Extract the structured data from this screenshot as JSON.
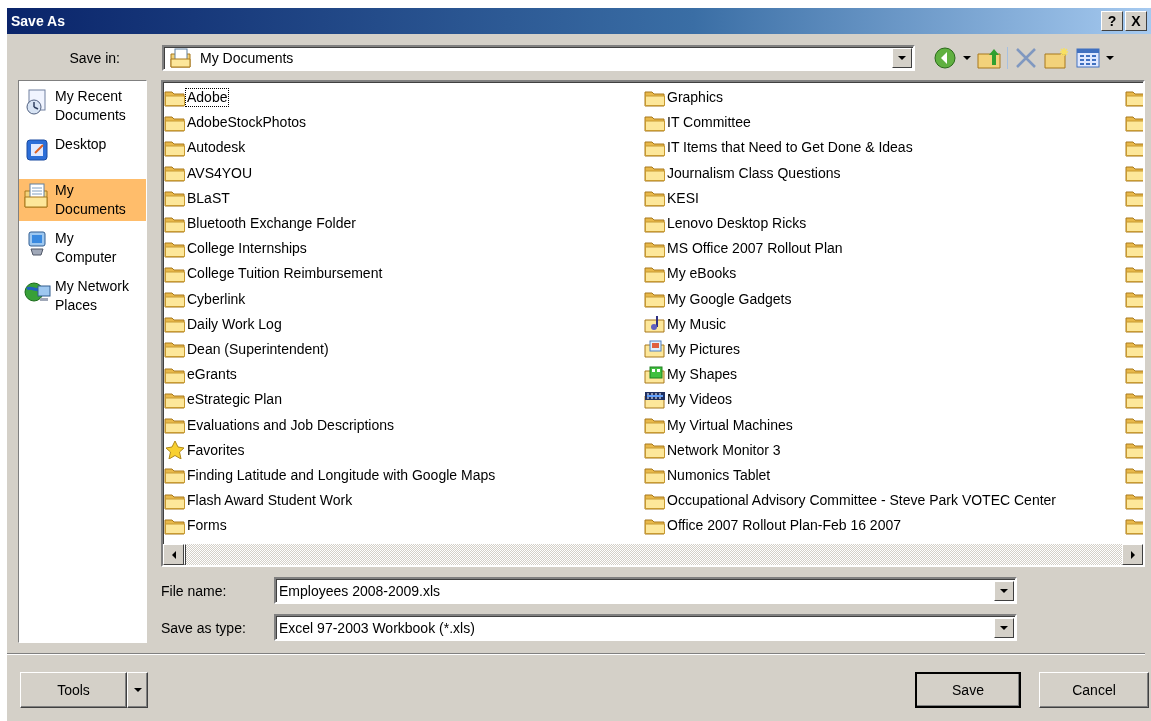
{
  "window": {
    "title": "Save As",
    "title_buttons": [
      "?",
      "X"
    ]
  },
  "save_in": {
    "label": "Save in:",
    "value": "My Documents"
  },
  "places": [
    {
      "kind": "recent",
      "label": "My Recent Documents",
      "selected": false
    },
    {
      "kind": "desktop",
      "label": "Desktop",
      "selected": false
    },
    {
      "kind": "documents",
      "label": "My Documents",
      "selected": true
    },
    {
      "kind": "computer",
      "label": "My Computer",
      "selected": false
    },
    {
      "kind": "network",
      "label": "My Network Places",
      "selected": false
    }
  ],
  "file_list": {
    "columns": [
      {
        "items": [
          {
            "kind": "folder",
            "label": "Adobe",
            "focused": true
          },
          {
            "kind": "folder",
            "label": "AdobeStockPhotos",
            "focused": false
          },
          {
            "kind": "folder",
            "label": "Autodesk",
            "focused": false
          },
          {
            "kind": "folder",
            "label": "AVS4YOU",
            "focused": false
          },
          {
            "kind": "folder",
            "label": "BLaST",
            "focused": false
          },
          {
            "kind": "folder",
            "label": "Bluetooth Exchange Folder",
            "focused": false
          },
          {
            "kind": "folder",
            "label": "College Internships",
            "focused": false
          },
          {
            "kind": "folder",
            "label": "College Tuition Reimbursement",
            "focused": false
          },
          {
            "kind": "folder",
            "label": "Cyberlink",
            "focused": false
          },
          {
            "kind": "folder",
            "label": "Daily Work Log",
            "focused": false
          },
          {
            "kind": "folder",
            "label": "Dean (Superintendent)",
            "focused": false
          },
          {
            "kind": "folder",
            "label": "eGrants",
            "focused": false
          },
          {
            "kind": "folder",
            "label": "eStrategic Plan",
            "focused": false
          },
          {
            "kind": "folder",
            "label": "Evaluations and Job Descriptions",
            "focused": false
          },
          {
            "kind": "favorites",
            "label": "Favorites",
            "focused": false
          },
          {
            "kind": "folder",
            "label": "Finding Latitude and Longitude with Google Maps",
            "focused": false
          },
          {
            "kind": "folder",
            "label": "Flash Award Student Work",
            "focused": false
          },
          {
            "kind": "folder",
            "label": "Forms",
            "focused": false
          }
        ]
      },
      {
        "items": [
          {
            "kind": "folder",
            "label": "Graphics",
            "focused": false
          },
          {
            "kind": "folder",
            "label": "IT Committee",
            "focused": false
          },
          {
            "kind": "folder",
            "label": "IT Items that Need to Get Done & Ideas",
            "focused": false
          },
          {
            "kind": "folder",
            "label": "Journalism Class Questions",
            "focused": false
          },
          {
            "kind": "folder",
            "label": "KESI",
            "focused": false
          },
          {
            "kind": "folder",
            "label": "Lenovo Desktop Ricks",
            "focused": false
          },
          {
            "kind": "folder",
            "label": "MS Office 2007 Rollout Plan",
            "focused": false
          },
          {
            "kind": "folder",
            "label": "My eBooks",
            "focused": false
          },
          {
            "kind": "folder",
            "label": "My Google Gadgets",
            "focused": false
          },
          {
            "kind": "music",
            "label": "My Music",
            "focused": false
          },
          {
            "kind": "pictures",
            "label": "My Pictures",
            "focused": false
          },
          {
            "kind": "shapes",
            "label": "My Shapes",
            "focused": false
          },
          {
            "kind": "videos",
            "label": "My Videos",
            "focused": false
          },
          {
            "kind": "folder",
            "label": "My Virtual Machines",
            "focused": false
          },
          {
            "kind": "folder",
            "label": "Network Monitor 3",
            "focused": false
          },
          {
            "kind": "folder",
            "label": "Numonics Tablet",
            "focused": false
          },
          {
            "kind": "folder",
            "label": "Occupational Advisory Committee - Steve Park VOTEC Center",
            "focused": false
          },
          {
            "kind": "folder",
            "label": "Office 2007 Rollout Plan-Feb 16 2007",
            "focused": false
          }
        ]
      },
      {
        "items": [
          {
            "kind": "folder"
          },
          {
            "kind": "folder"
          },
          {
            "kind": "folder"
          },
          {
            "kind": "folder"
          },
          {
            "kind": "folder"
          },
          {
            "kind": "folder"
          },
          {
            "kind": "folder"
          },
          {
            "kind": "folder"
          },
          {
            "kind": "folder"
          },
          {
            "kind": "folder"
          },
          {
            "kind": "folder"
          },
          {
            "kind": "folder"
          },
          {
            "kind": "folder"
          },
          {
            "kind": "folder"
          },
          {
            "kind": "folder"
          },
          {
            "kind": "folder"
          },
          {
            "kind": "folder"
          },
          {
            "kind": "folder"
          }
        ]
      }
    ]
  },
  "file_name": {
    "label": "File name:",
    "value": "Employees 2008-2009.xls"
  },
  "save_as_type": {
    "label": "Save as type:",
    "value": "Excel 97-2003 Workbook (*.xls)"
  },
  "buttons": [
    {
      "kind": "split",
      "label": "Tools"
    },
    {
      "kind": "default",
      "label": "Save"
    },
    {
      "kind": "normal",
      "label": "Cancel"
    }
  ]
}
